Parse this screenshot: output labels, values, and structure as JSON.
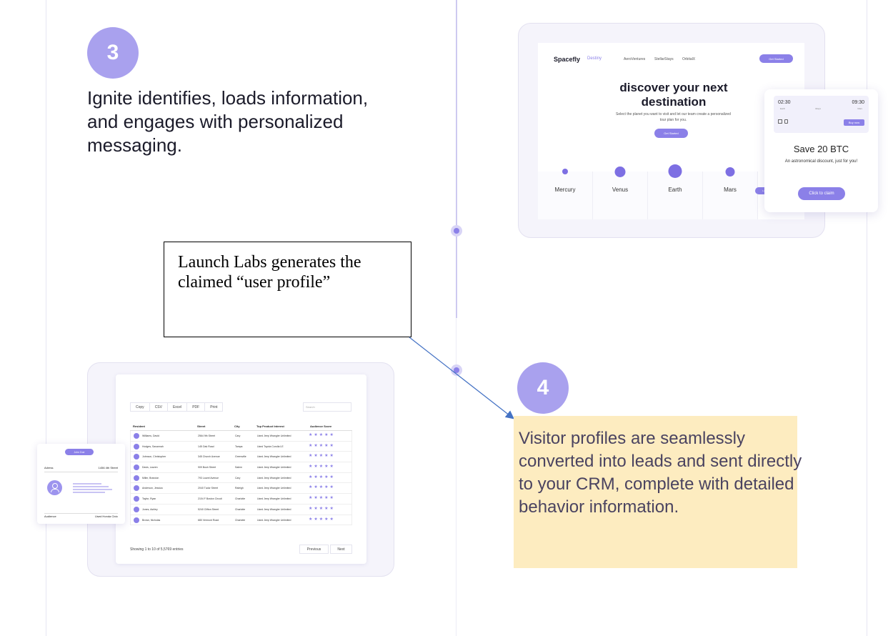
{
  "step3": {
    "number": "3",
    "text": "Ignite identifies, loads information, and engages with personalized messaging."
  },
  "step4": {
    "number": "4",
    "text": "Visitor profiles are seamlessly converted into leads and sent directly to your CRM, complete with detailed behavior information."
  },
  "callout": {
    "text": "Launch Labs generates the claimed “user profile”"
  },
  "colors": {
    "accent": "#8b80e8",
    "step_circle": "#a9a1ee",
    "highlight": "#fdecc0"
  },
  "spacefly": {
    "logo": "Spacefly",
    "logo_sub": "Destiny",
    "nav": [
      "AeroVentures",
      "StellarStays",
      "OrbitalX"
    ],
    "cta": "Get Started",
    "hero": "discover your next destination",
    "sub": "Select the planet you want to visit and let our team create a personalized tour plan for you.",
    "hero_button": "Get Started",
    "planets": [
      "Mercury",
      "Venus",
      "Earth",
      "Mars"
    ],
    "lore_tag": "Lore Remastry",
    "promo": {
      "time_depart": "02:30",
      "time_arrive": "09:30",
      "depart_label": "Earth",
      "mid_label": "3days",
      "arrive_label": "Mars",
      "ticket_button": "Buy now",
      "title": "Save 20 BTC",
      "text": "An astronomical discount, just for you!",
      "button": "Click to claim"
    }
  },
  "leads_table": {
    "export_buttons": [
      "Copy",
      "CSV",
      "Excel",
      "PDF",
      "Print"
    ],
    "search_placeholder": "Search",
    "columns": [
      "Resident",
      "Street",
      "City",
      "Top Product Interest",
      "Audience Score"
    ],
    "rows": [
      [
        "Williams, David",
        "2564 9th Street",
        "Cary",
        "Used Jeep Wrangler Unlimited"
      ],
      [
        "Hodges, Savannah",
        "145 Oak Road",
        "Tampa",
        "Used Toyota Corolla LE"
      ],
      [
        "Johnson, Christopher",
        "345 Church Avenue",
        "Greenville",
        "Used Jeep Wrangler Unlimited"
      ],
      [
        "Davis, Lauren",
        "909 Bush Street",
        "Salem",
        "Used Jeep Wrangler Unlimited"
      ],
      [
        "Miller, Brandon",
        "793 Laurel Avenue",
        "Cary",
        "Used Jeep Wrangler Unlimited"
      ],
      [
        "Anderson, Jessica",
        "2040 Tudor Street",
        "Raleigh",
        "Used Jeep Wrangler Unlimited"
      ],
      [
        "Taylor, Ryan",
        "2104 F Boston Circuit",
        "Charlotte",
        "Used Jeep Wrangler Unlimited"
      ],
      [
        "Jones, Ashley",
        "5240 Clifton Street",
        "Charlotte",
        "Used Jeep Wrangler Unlimited"
      ],
      [
        "Brown, Nicholas",
        "680 Vermont Road",
        "Charlotte",
        "Used Jeep Wrangler Unlimited"
      ]
    ],
    "rating_stars": 5,
    "showing": "Showing 1 to 10 of 5,5769 entries",
    "previous": "Previous",
    "next": "Next"
  },
  "profile_card": {
    "name": "John Doe",
    "address_label": "Adress",
    "address_value": "1456 4th Street",
    "audience_label": "Audience",
    "audience_value": "Used Honda Civic"
  }
}
